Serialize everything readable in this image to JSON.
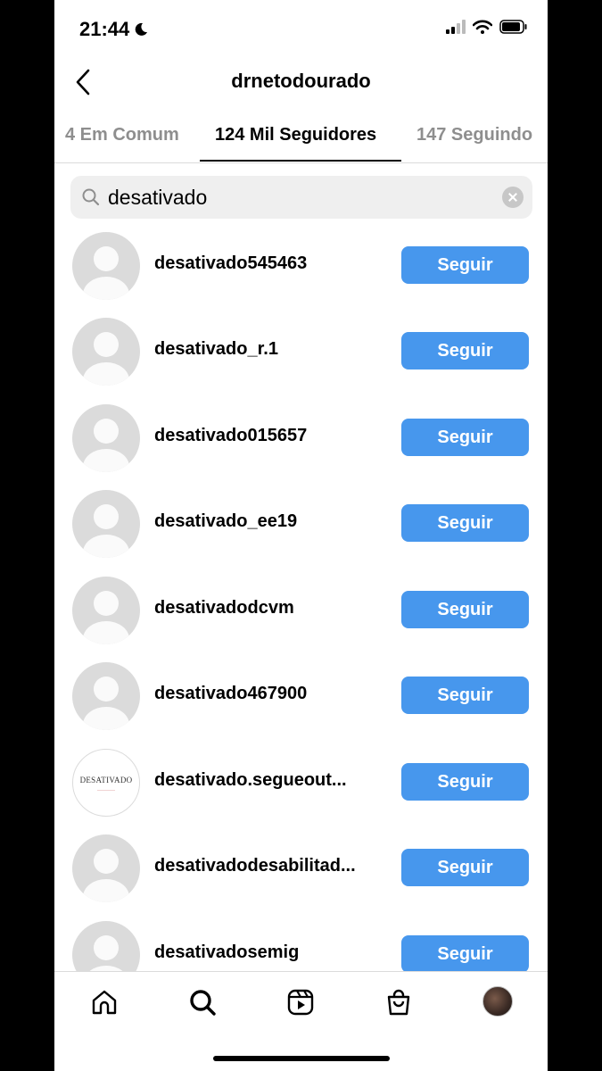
{
  "status_bar": {
    "time": "21:44"
  },
  "header": {
    "title": "drnetodourado"
  },
  "tabs": [
    {
      "label": "4 Em Comum"
    },
    {
      "label": "124 Mil Seguidores"
    },
    {
      "label": "147 Seguindo"
    }
  ],
  "search": {
    "value": "desativado"
  },
  "follow_label": "Seguir",
  "results": [
    {
      "username": "desativado545463",
      "avatar": "default"
    },
    {
      "username": "desativado_r.1",
      "avatar": "default"
    },
    {
      "username": "desativado015657",
      "avatar": "default"
    },
    {
      "username": "desativado_ee19",
      "avatar": "default"
    },
    {
      "username": "desativadodcvm",
      "avatar": "default"
    },
    {
      "username": "desativado467900",
      "avatar": "default"
    },
    {
      "username": "desativado.segueout...",
      "avatar": "logo",
      "avatar_text": "DESATIVADO"
    },
    {
      "username": "desativadodesabilitad...",
      "avatar": "default"
    },
    {
      "username": "desativadosemig",
      "avatar": "default"
    }
  ],
  "bottom_nav": [
    "home-icon",
    "search-icon",
    "reels-icon",
    "shop-icon",
    "profile-avatar"
  ],
  "colors": {
    "follow_button": "#4797ed",
    "inactive_tab": "#8e8e8e"
  }
}
